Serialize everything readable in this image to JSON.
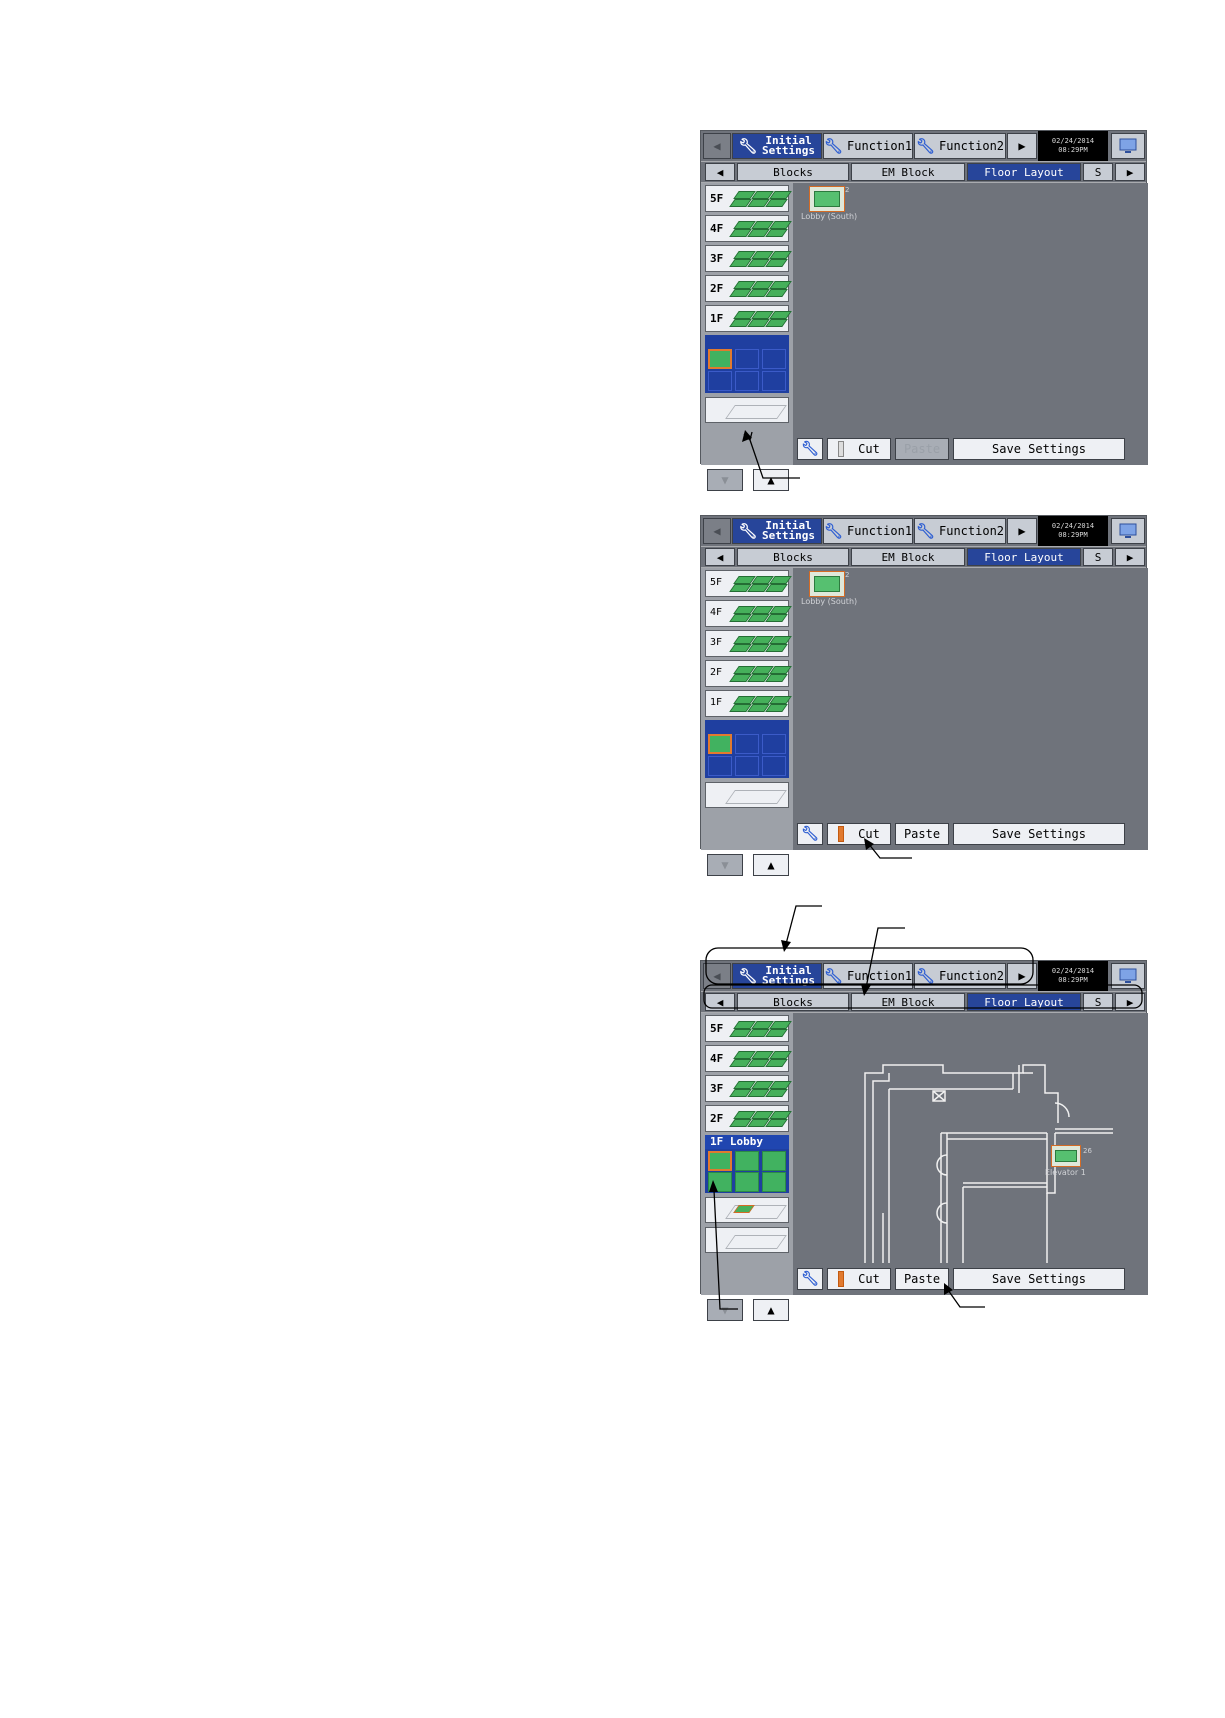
{
  "screens": [
    {
      "tabs": [
        "Initial Settings",
        "Function1",
        "Function2"
      ],
      "clock": {
        "date": "02/24/2014",
        "time": "08:29PM"
      },
      "subtabs": [
        "Blocks",
        "EM Block",
        "Floor Layout",
        "S"
      ],
      "floors": [
        "5F",
        "4F",
        "3F",
        "2F",
        "1F"
      ],
      "unit": {
        "label": "Lobby (South)",
        "number": "2"
      },
      "buttons": {
        "cut": "Cut",
        "paste": "Paste",
        "save": "Save Settings"
      }
    },
    {
      "tabs": [
        "Initial Settings",
        "Function1",
        "Function2"
      ],
      "clock": {
        "date": "02/24/2014",
        "time": "08:29PM"
      },
      "subtabs": [
        "Blocks",
        "EM Block",
        "Floor Layout",
        "S"
      ],
      "floors": [
        "5F",
        "4F",
        "3F",
        "2F",
        "1F"
      ],
      "unit": {
        "label": "Lobby (South)",
        "number": "2"
      },
      "buttons": {
        "cut": "Cut",
        "paste": "Paste",
        "save": "Save Settings"
      }
    },
    {
      "tabs": [
        "Initial Settings",
        "Function1",
        "Function2"
      ],
      "clock": {
        "date": "02/24/2014",
        "time": "08:29PM"
      },
      "subtabs": [
        "Blocks",
        "EM Block",
        "Floor Layout",
        "S"
      ],
      "floors": [
        "5F",
        "4F",
        "3F",
        "2F"
      ],
      "lobby_header": "1F Lobby",
      "unit": {
        "label": "Elevator 1",
        "number": "26"
      },
      "buttons": {
        "cut": "Cut",
        "paste": "Paste",
        "save": "Save Settings"
      }
    }
  ],
  "colors": {
    "active_tab": "#27459a",
    "tile_green": "#46b05b",
    "selection_orange": "#e17a2f",
    "map_bg": "#6f737b"
  }
}
